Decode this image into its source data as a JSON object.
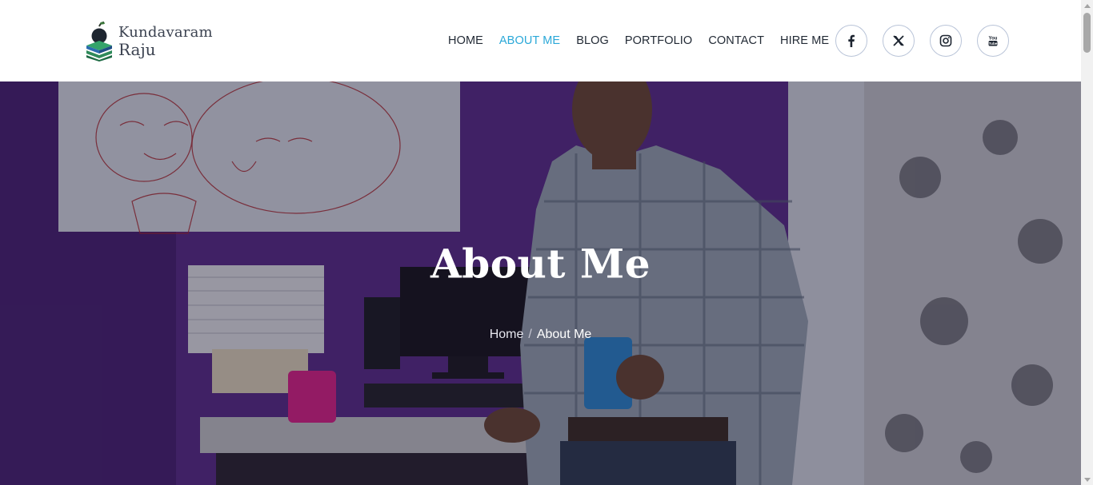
{
  "brand": {
    "line1": "Kundavaram",
    "line2": "Raju"
  },
  "nav": {
    "items": [
      {
        "label": "HOME",
        "active": false
      },
      {
        "label": "ABOUT ME",
        "active": true
      },
      {
        "label": "BLOG",
        "active": false
      },
      {
        "label": "PORTFOLIO",
        "active": false
      },
      {
        "label": "CONTACT",
        "active": false
      },
      {
        "label": "HIRE ME",
        "active": false
      }
    ],
    "active_color": "#2aa8d8"
  },
  "socials": [
    {
      "icon": "facebook-icon"
    },
    {
      "icon": "x-icon"
    },
    {
      "icon": "instagram-icon"
    },
    {
      "icon": "youtube-icon"
    }
  ],
  "hero": {
    "title": "About Me",
    "breadcrumb": {
      "home": "Home",
      "separator": "/",
      "current": "About Me"
    }
  },
  "colors": {
    "accent": "#2aa8d8",
    "wall_purple": "#5b2b8c",
    "text_dark": "#222a35"
  }
}
